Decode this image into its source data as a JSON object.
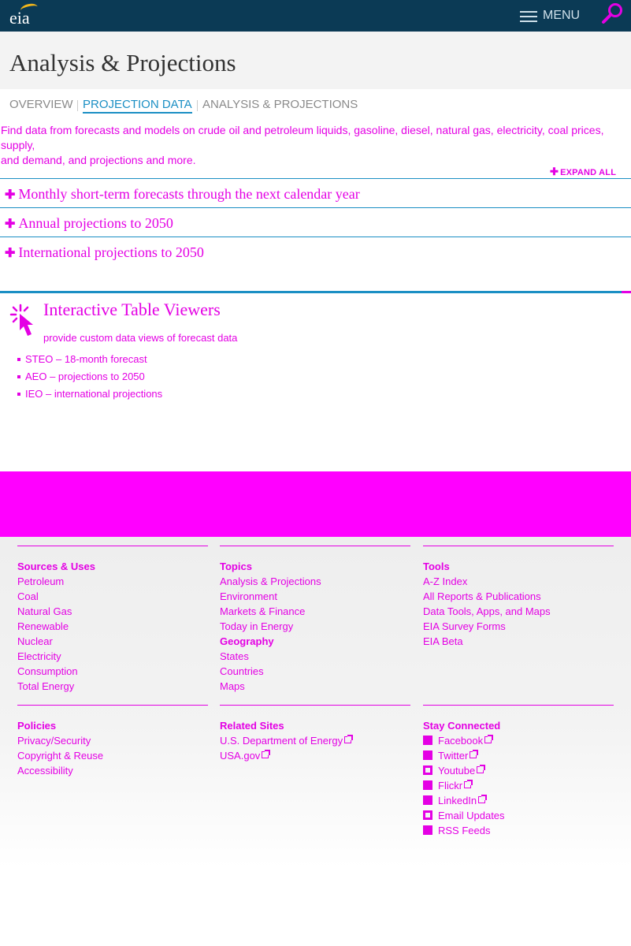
{
  "brand": {
    "logo_text": "eia"
  },
  "header": {
    "menu_label": "MENU"
  },
  "page": {
    "title": "Analysis & Projections"
  },
  "tabs": [
    {
      "label": "OVERVIEW"
    },
    {
      "label": "PROJECTION DATA"
    },
    {
      "label": "ANALYSIS & PROJECTIONS"
    }
  ],
  "intro": {
    "line1": "Find data from forecasts and models on crude oil and petroleum liquids, gasoline, diesel, natural gas, electricity, coal prices, supply,",
    "line2": "and demand, and projections and more."
  },
  "accordion": {
    "expand_all": "EXPAND ALL",
    "items": [
      {
        "label": "Monthly short-term forecasts through the next calendar year"
      },
      {
        "label": "Annual projections to 2050"
      },
      {
        "label": "International projections to 2050"
      }
    ]
  },
  "viewers": {
    "title": "Interactive Table Viewers",
    "desc": "provide custom data views of forecast data",
    "items": [
      {
        "label": "STEO – 18-month forecast"
      },
      {
        "label": "AEO – projections to 2050"
      },
      {
        "label": "IEO – international projections"
      }
    ]
  },
  "footer": {
    "sources": {
      "heading": "Sources & Uses",
      "links": [
        "Petroleum",
        "Coal",
        "Natural Gas",
        "Renewable",
        "Nuclear",
        "Electricity",
        "Consumption",
        "Total Energy"
      ]
    },
    "topics": {
      "heading": "Topics",
      "links": [
        "Analysis & Projections",
        "Environment",
        "Markets & Finance",
        "Today in Energy"
      ]
    },
    "geography": {
      "heading": "Geography",
      "links": [
        "States",
        "Countries",
        "Maps"
      ]
    },
    "tools": {
      "heading": "Tools",
      "links": [
        "A-Z Index",
        "All Reports & Publications",
        "Data Tools, Apps, and Maps",
        "EIA Survey Forms",
        "EIA Beta"
      ]
    },
    "policies": {
      "heading": "Policies",
      "links": [
        "Privacy/Security",
        "Copyright & Reuse",
        "Accessibility"
      ]
    },
    "related": {
      "heading": "Related Sites",
      "links": [
        "U.S. Department of Energy",
        "USA.gov"
      ]
    },
    "connected": {
      "heading": "Stay Connected",
      "links": [
        "Facebook",
        "Twitter",
        "Youtube",
        "Flickr",
        "LinkedIn",
        "Email Updates",
        "RSS Feeds"
      ]
    }
  },
  "colors": {
    "header_bg": "#0b3a55",
    "accent_blue": "#1b8fc4",
    "magenta": "#e400e4",
    "band": "#ff00ff"
  },
  "icons": {
    "search": "search-icon",
    "menu": "hamburger-icon",
    "viewer": "cursor-click-icon"
  }
}
